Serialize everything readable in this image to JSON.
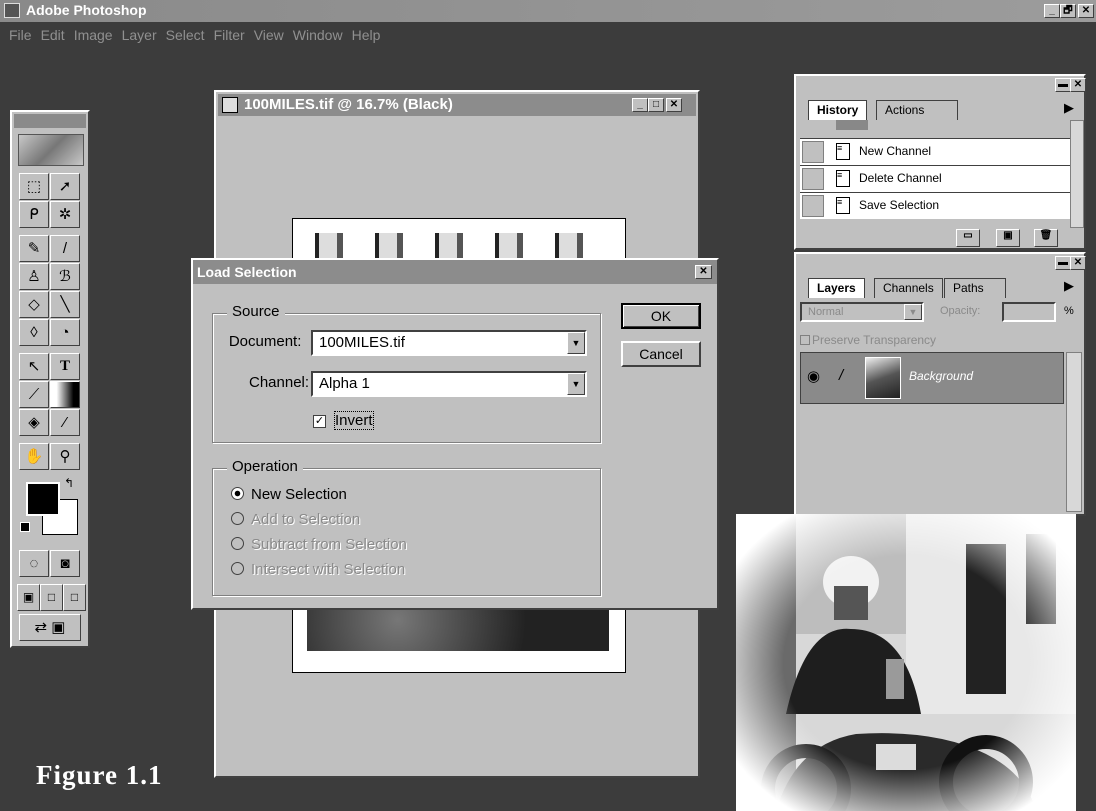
{
  "app": {
    "title": "Adobe Photoshop",
    "menu": [
      "File",
      "Edit",
      "Image",
      "Layer",
      "Select",
      "Filter",
      "View",
      "Window",
      "Help"
    ],
    "win_controls": [
      "_",
      "🗗",
      "✕"
    ]
  },
  "document_window": {
    "title": "100MILES.tif @ 16.7% (Black)",
    "controls": [
      "_",
      "□",
      "✕"
    ]
  },
  "history_panel": {
    "tabs": [
      "History",
      "Actions"
    ],
    "items": [
      "New Channel",
      "Delete Channel",
      "Save Selection"
    ],
    "buttons": [
      "new-snapshot-icon",
      "new-document-icon",
      "trash-icon"
    ]
  },
  "layers_panel": {
    "tabs": [
      "Layers",
      "Channels",
      "Paths"
    ],
    "blend_mode": "Normal",
    "opacity_label": "Opacity:",
    "percent": "%",
    "preserve_transparency": "Preserve Transparency",
    "layer_name": "Background"
  },
  "load_selection_dialog": {
    "title": "Load Selection",
    "close": "✕",
    "source_label": "Source",
    "document_label": "Document:",
    "document_value": "100MILES.tif",
    "channel_label": "Channel:",
    "channel_value": "Alpha 1",
    "invert_label": "Invert",
    "invert_checked": true,
    "ok_label": "OK",
    "cancel_label": "Cancel",
    "operation_label": "Operation",
    "operations": [
      "New Selection",
      "Add to Selection",
      "Subtract from Selection",
      "Intersect with Selection"
    ],
    "selected_operation": "New Selection"
  },
  "caption": "Figure 1.1"
}
